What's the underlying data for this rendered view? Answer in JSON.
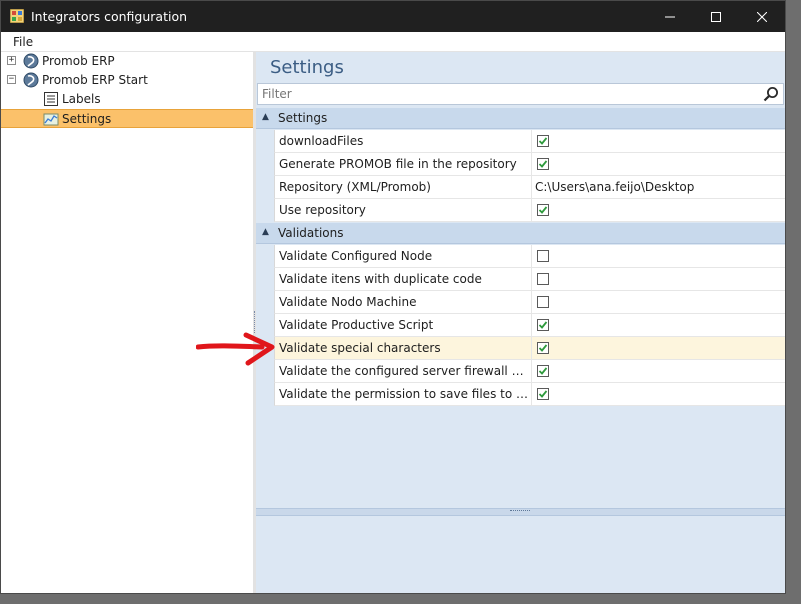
{
  "window": {
    "title": "Integrators configuration"
  },
  "menu": {
    "file": "File"
  },
  "tree": {
    "items": [
      {
        "label": "Promob ERP",
        "expander": "+"
      },
      {
        "label": "Promob ERP Start",
        "expander": "−"
      },
      {
        "label": "Labels"
      },
      {
        "label": "Settings",
        "selected": true
      }
    ]
  },
  "panel": {
    "title": "Settings",
    "filter_placeholder": "Filter"
  },
  "grid": {
    "categories": [
      {
        "label": "Settings",
        "props": [
          {
            "name": "downloadFiles",
            "type": "bool",
            "checked": true
          },
          {
            "name": "Generate PROMOB file in the repository",
            "type": "bool",
            "checked": true
          },
          {
            "name": "Repository (XML/Promob)",
            "type": "text",
            "value": "C:\\Users\\ana.feijo\\Desktop"
          },
          {
            "name": "Use repository",
            "type": "bool",
            "checked": true
          }
        ]
      },
      {
        "label": "Validations",
        "props": [
          {
            "name": "Validate Configured Node",
            "type": "bool",
            "checked": false
          },
          {
            "name": "Validate itens with duplicate code",
            "type": "bool",
            "checked": false
          },
          {
            "name": "Validate Nodo Machine",
            "type": "bool",
            "checked": false
          },
          {
            "name": "Validate Productive Script",
            "type": "bool",
            "checked": true
          },
          {
            "name": "Validate special characters",
            "type": "bool",
            "checked": true
          },
          {
            "name": "Validate the configured server firewall port is op...",
            "type": "bool",
            "checked": true
          },
          {
            "name": "Validate the permission to save files to configure...",
            "type": "bool",
            "checked": true
          }
        ]
      }
    ]
  },
  "colors": {
    "selection": "#fbc16a",
    "check_green": "#2e9a3c",
    "annotation_arrow": "#e0161b"
  }
}
